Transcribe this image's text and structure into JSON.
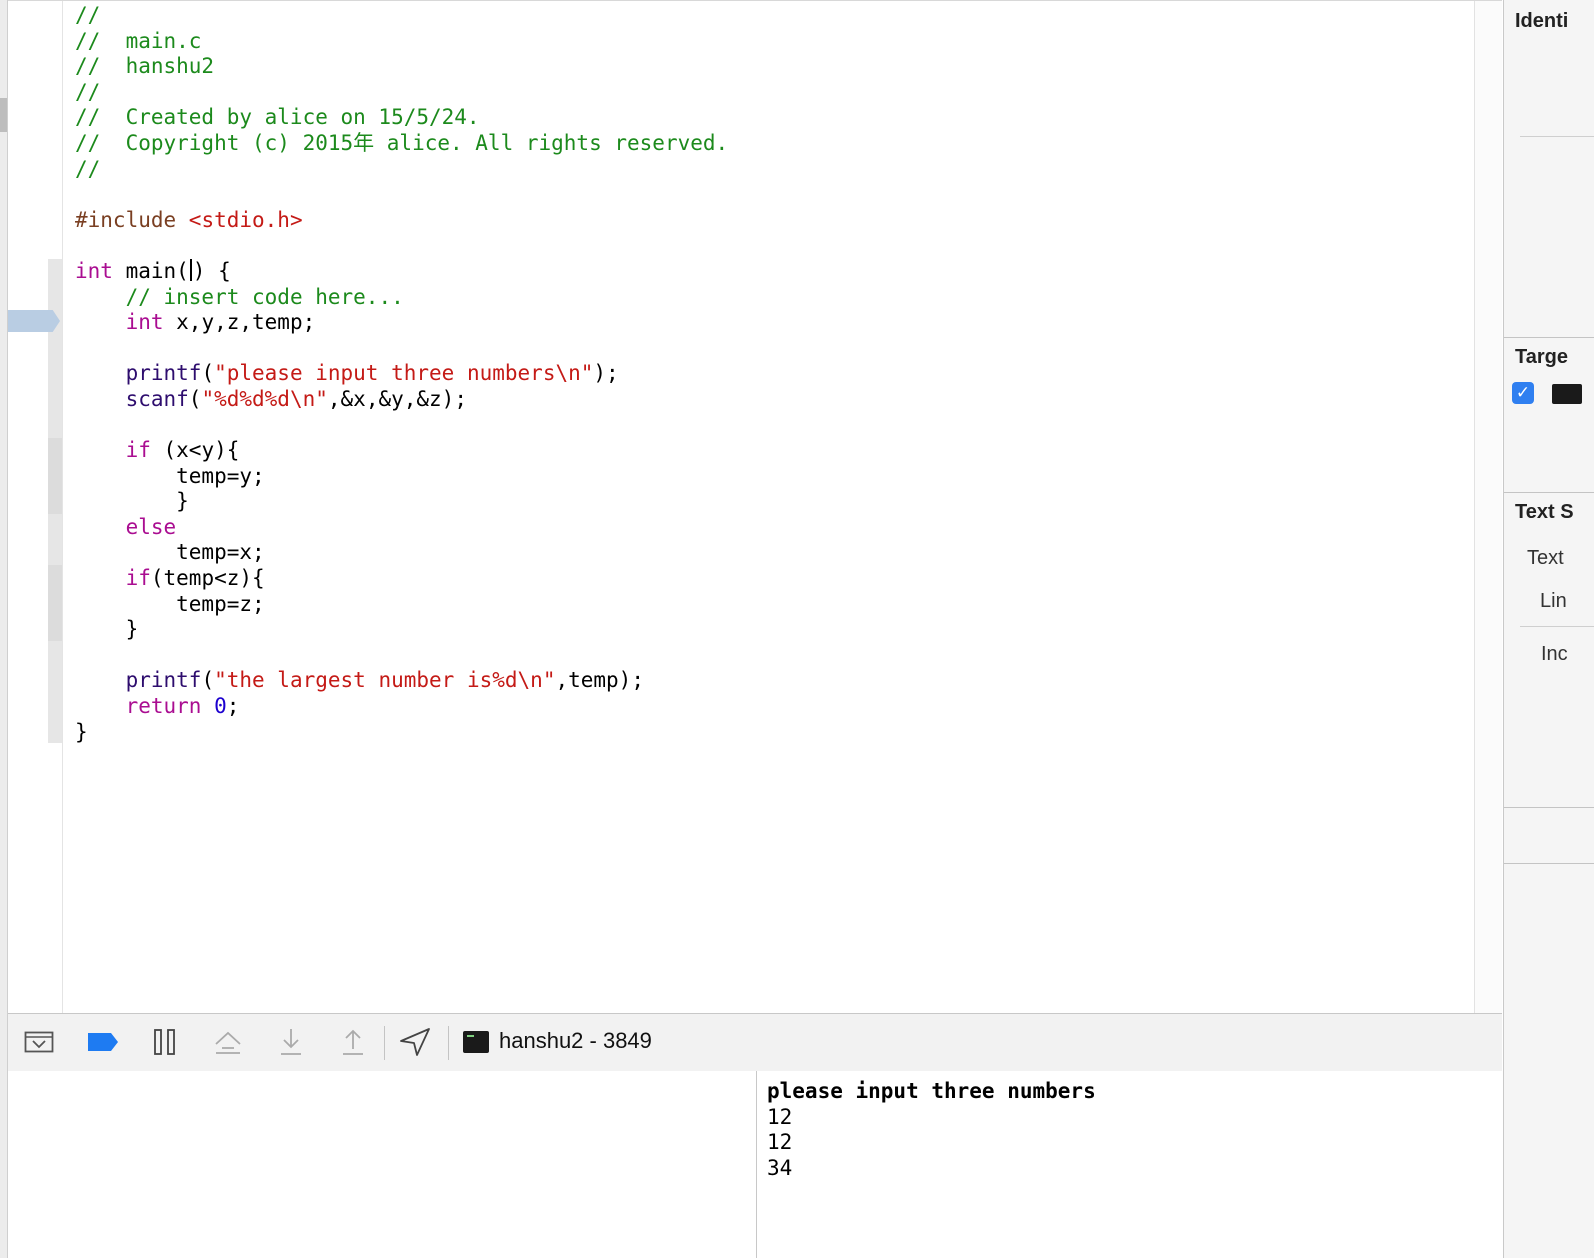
{
  "editor": {
    "filename_comment": "//  main.c",
    "code_lines": [
      [
        {
          "t": "//",
          "c": "cm"
        }
      ],
      [
        {
          "t": "//  main.c",
          "c": "cm"
        }
      ],
      [
        {
          "t": "//  hanshu2",
          "c": "cm"
        }
      ],
      [
        {
          "t": "//",
          "c": "cm"
        }
      ],
      [
        {
          "t": "//  Created by alice on 15/5/24.",
          "c": "cm"
        }
      ],
      [
        {
          "t": "//  Copyright (c) 2015年 alice. All rights reserved.",
          "c": "cm"
        }
      ],
      [
        {
          "t": "//",
          "c": "cm"
        }
      ],
      [],
      [
        {
          "t": "#include ",
          "c": "pp"
        },
        {
          "t": "<stdio.h>",
          "c": "str"
        }
      ],
      [],
      [
        {
          "t": "int",
          "c": "kw"
        },
        {
          "t": " main("
        },
        {
          "caret": true
        },
        {
          "t": ") {"
        }
      ],
      [
        {
          "t": "    "
        },
        {
          "t": "// insert code here...",
          "c": "cm"
        }
      ],
      [
        {
          "t": "    "
        },
        {
          "t": "int",
          "c": "kw"
        },
        {
          "t": " x,y,z,temp;"
        }
      ],
      [],
      [
        {
          "t": "    "
        },
        {
          "t": "printf",
          "c": "fn"
        },
        {
          "t": "("
        },
        {
          "t": "\"please input three numbers\\n\"",
          "c": "str"
        },
        {
          "t": ");"
        }
      ],
      [
        {
          "t": "    "
        },
        {
          "t": "scanf",
          "c": "fn"
        },
        {
          "t": "("
        },
        {
          "t": "\"%d%d%d\\n\"",
          "c": "str"
        },
        {
          "t": ",&x,&y,&z);"
        }
      ],
      [],
      [
        {
          "t": "    "
        },
        {
          "t": "if",
          "c": "kw"
        },
        {
          "t": " (x<y){"
        }
      ],
      [
        {
          "t": "        temp=y;"
        }
      ],
      [
        {
          "t": "        }"
        }
      ],
      [
        {
          "t": "    "
        },
        {
          "t": "else",
          "c": "kw"
        }
      ],
      [
        {
          "t": "        temp=x;"
        }
      ],
      [
        {
          "t": "    "
        },
        {
          "t": "if",
          "c": "kw"
        },
        {
          "t": "(temp<z){"
        }
      ],
      [
        {
          "t": "        temp=z;"
        }
      ],
      [
        {
          "t": "    }"
        }
      ],
      [],
      [
        {
          "t": "    "
        },
        {
          "t": "printf",
          "c": "fn"
        },
        {
          "t": "("
        },
        {
          "t": "\"the largest number is%d\\n\"",
          "c": "str"
        },
        {
          "t": ",temp);"
        }
      ],
      [
        {
          "t": "    "
        },
        {
          "t": "return",
          "c": "kw"
        },
        {
          "t": " "
        },
        {
          "t": "0",
          "c": "num"
        },
        {
          "t": ";"
        }
      ],
      [
        {
          "t": "}"
        }
      ]
    ]
  },
  "debug_bar": {
    "process_label": "hanshu2 - 3849",
    "buttons": [
      {
        "name": "hide-debug-area-button",
        "icon": "chevron-down-box-icon"
      },
      {
        "name": "breakpoints-toggle-button",
        "icon": "breakpoint-icon"
      },
      {
        "name": "pause-button",
        "icon": "pause-icon"
      },
      {
        "name": "step-over-button",
        "icon": "step-over-icon"
      },
      {
        "name": "step-into-button",
        "icon": "step-into-icon"
      },
      {
        "name": "step-out-button",
        "icon": "step-out-icon"
      },
      {
        "name": "simulate-location-button",
        "icon": "location-arrow-icon"
      }
    ]
  },
  "console": {
    "lines": [
      "please input three numbers",
      "12",
      "12",
      "34"
    ]
  },
  "inspector": {
    "identity_header": "Identi",
    "target_header": "Targe",
    "text_settings_header": "Text S",
    "text_encoding_label": "Text",
    "line_endings_label": "Lin",
    "indent_label": "Inc",
    "target_checked": true
  },
  "colors": {
    "comment": "#1c8a1c",
    "string": "#c41a16",
    "keyword": "#aa0d91",
    "function": "#2e0d6e",
    "preprocessor": "#7a3f22",
    "number": "#1c00cf",
    "breakpoints_blue": "#1e7bf2"
  }
}
